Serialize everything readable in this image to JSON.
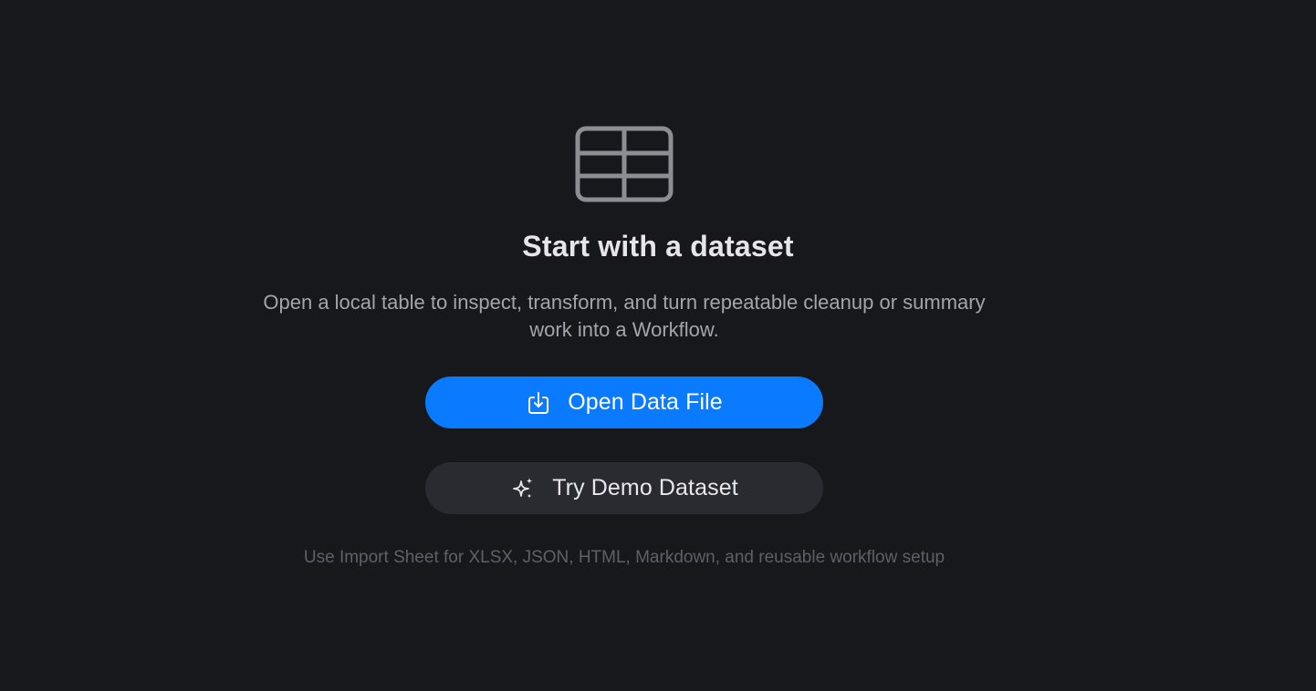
{
  "empty_state": {
    "icon": "table-icon",
    "title": "Start with a dataset",
    "description": "Open a local table to inspect, transform, and turn repeatable cleanup or summary work into a Workflow.",
    "primary_button": {
      "label": "Open Data File",
      "icon": "import-file-icon",
      "color": "#0a7aff"
    },
    "secondary_button": {
      "label": "Try Demo Dataset",
      "icon": "sparkles-icon"
    },
    "footnote": "Use Import Sheet for XLSX, JSON, HTML, Markdown, and reusable workflow setup"
  }
}
